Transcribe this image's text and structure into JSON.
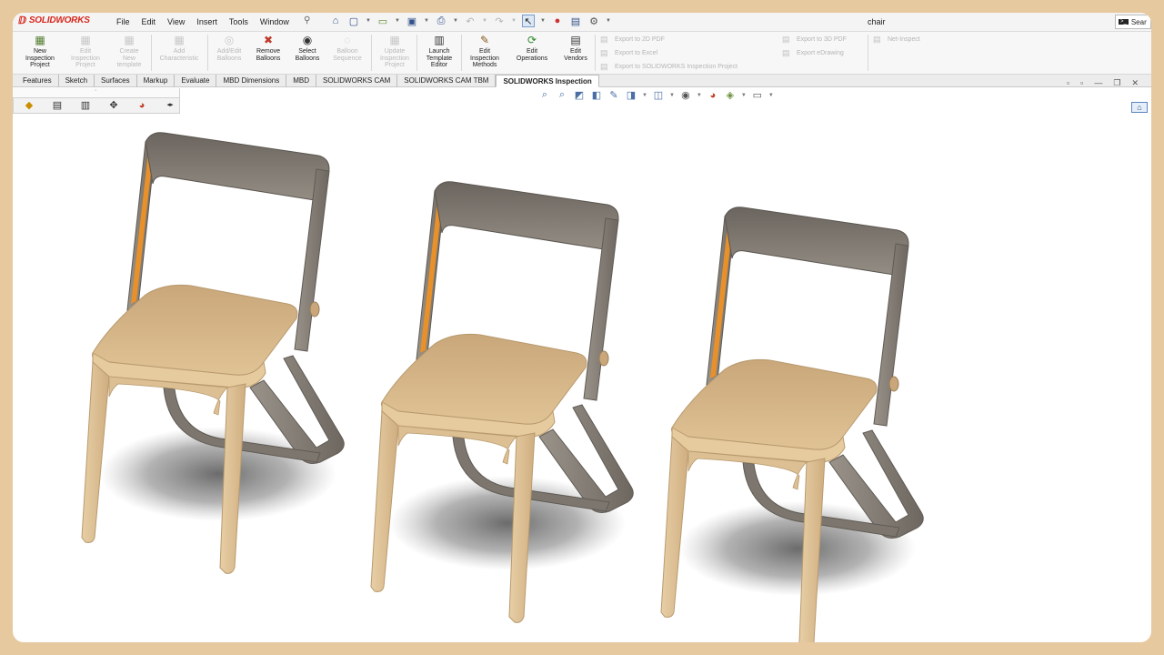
{
  "app": {
    "name": "SOLIDWORKS",
    "document_title": "chair"
  },
  "menu": [
    "File",
    "Edit",
    "View",
    "Insert",
    "Tools",
    "Window"
  ],
  "search": {
    "label": "Sear"
  },
  "command_buttons": [
    {
      "label": "New\nInspection\nProject",
      "enabled": true,
      "icon": "new-inspection-project-icon"
    },
    {
      "label": "Edit\nInspection\nProject",
      "enabled": false,
      "icon": "edit-inspection-project-icon"
    },
    {
      "label": "Create\nNew\ntemplate",
      "enabled": false,
      "icon": "create-template-icon"
    },
    {
      "label": "Add\nCharacteristic",
      "enabled": false,
      "icon": "add-characteristic-icon"
    },
    {
      "label": "Add/Edit\nBalloons",
      "enabled": false,
      "icon": "add-edit-balloons-icon"
    },
    {
      "label": "Remove\nBalloons",
      "enabled": true,
      "icon": "remove-balloons-icon"
    },
    {
      "label": "Select\nBalloons",
      "enabled": true,
      "icon": "select-balloons-icon"
    },
    {
      "label": "Balloon\nSequence",
      "enabled": false,
      "icon": "balloon-sequence-icon"
    },
    {
      "label": "Update\nInspection\nProject",
      "enabled": false,
      "icon": "update-project-icon"
    },
    {
      "label": "Launch\nTemplate\nEditor",
      "enabled": true,
      "icon": "template-editor-icon"
    },
    {
      "label": "Edit\nInspection\nMethods",
      "enabled": true,
      "icon": "inspection-methods-icon"
    },
    {
      "label": "Edit\nOperations",
      "enabled": true,
      "icon": "operations-icon"
    },
    {
      "label": "Edit\nVendors",
      "enabled": true,
      "icon": "vendors-icon"
    }
  ],
  "exports": [
    "Export to 2D PDF",
    "Export to Excel",
    "Export to SOLIDWORKS Inspection Project",
    "Export to 3D PDF",
    "Export eDrawing",
    "Net-Inspect"
  ],
  "tabs": [
    "Features",
    "Sketch",
    "Surfaces",
    "Markup",
    "Evaluate",
    "MBD Dimensions",
    "MBD",
    "SOLIDWORKS CAM",
    "SOLIDWORKS CAM TBM",
    "SOLIDWORKS Inspection"
  ],
  "active_tab": "SOLIDWORKS Inspection",
  "colors": {
    "accent": "#d8261c",
    "seat": "#d8b98a",
    "frame": "#8a837b",
    "edge_highlight": "#e8902a",
    "border": "#e7c9a0"
  }
}
